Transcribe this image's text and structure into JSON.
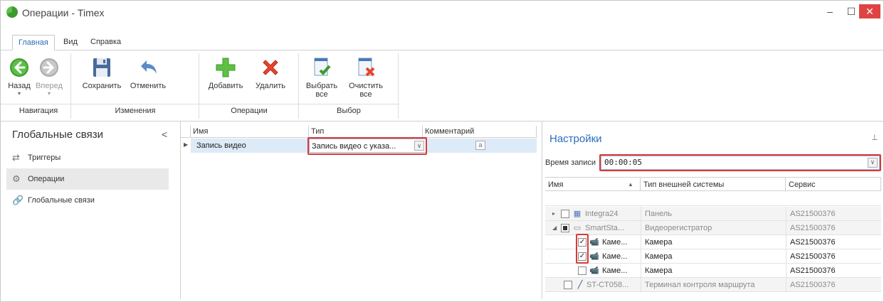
{
  "window": {
    "title": "Операции - Timex",
    "min_icon": "minimize-icon",
    "max_icon": "maximize-icon",
    "close_icon": "close-icon"
  },
  "ribbon": {
    "tabs": [
      "Главная",
      "Вид",
      "Справка"
    ],
    "buttons": {
      "back": "Назад",
      "forward": "Вперед",
      "save": "Сохранить",
      "undo": "Отменить",
      "add": "Добавить",
      "delete": "Удалить",
      "select_all_1": "Выбрать",
      "select_all_2": "все",
      "clear_all_1": "Очистить",
      "clear_all_2": "все"
    },
    "groups": {
      "navigation": "Навигация",
      "changes": "Изменения",
      "operations": "Операции",
      "selection": "Выбор"
    }
  },
  "leftnav": {
    "title": "Глобальные связи",
    "collapse": "<",
    "items": [
      {
        "label": "Триггеры",
        "icon": "arrows-icon"
      },
      {
        "label": "Операции",
        "icon": "gear-icon"
      },
      {
        "label": "Глобальные связи",
        "icon": "link-icon"
      }
    ]
  },
  "grid": {
    "headers": [
      "Имя",
      "Тип",
      "Комментарий"
    ],
    "rows": [
      {
        "name": "Запись видео",
        "type": "Запись видео с указа...",
        "comment_icon": "a"
      }
    ]
  },
  "settings": {
    "title": "Настройки",
    "record_label": "Время записи",
    "record_value": "00:00:05",
    "headers": [
      "Имя",
      "Тип внешней системы",
      "Сервис"
    ],
    "rows": [
      {
        "name": "Integra24",
        "type": "Панель",
        "service": "AS21500376",
        "checked": false,
        "level": 0,
        "expander": "▸",
        "gray": true
      },
      {
        "name": "SmartSta...",
        "type": "Видеорегистратор",
        "service": "AS21500376",
        "checked": "partial",
        "level": 0,
        "expander": "◢",
        "gray": true
      },
      {
        "name": "Каме...",
        "type": "Камера",
        "service": "AS21500376",
        "checked": true,
        "level": 1,
        "gray": false
      },
      {
        "name": "Каме...",
        "type": "Камера",
        "service": "AS21500376",
        "checked": true,
        "level": 1,
        "gray": false
      },
      {
        "name": "Каме...",
        "type": "Камера",
        "service": "AS21500376",
        "checked": false,
        "level": 1,
        "gray": false
      },
      {
        "name": "ST-CT058...",
        "type": "Терминал контроля маршрута",
        "service": "AS21500376",
        "checked": false,
        "level": 0,
        "gray": true
      }
    ]
  },
  "colors": {
    "accent": "#2a6ebb",
    "highlight": "#d93a3a",
    "selected_row": "#ddeaf7"
  }
}
